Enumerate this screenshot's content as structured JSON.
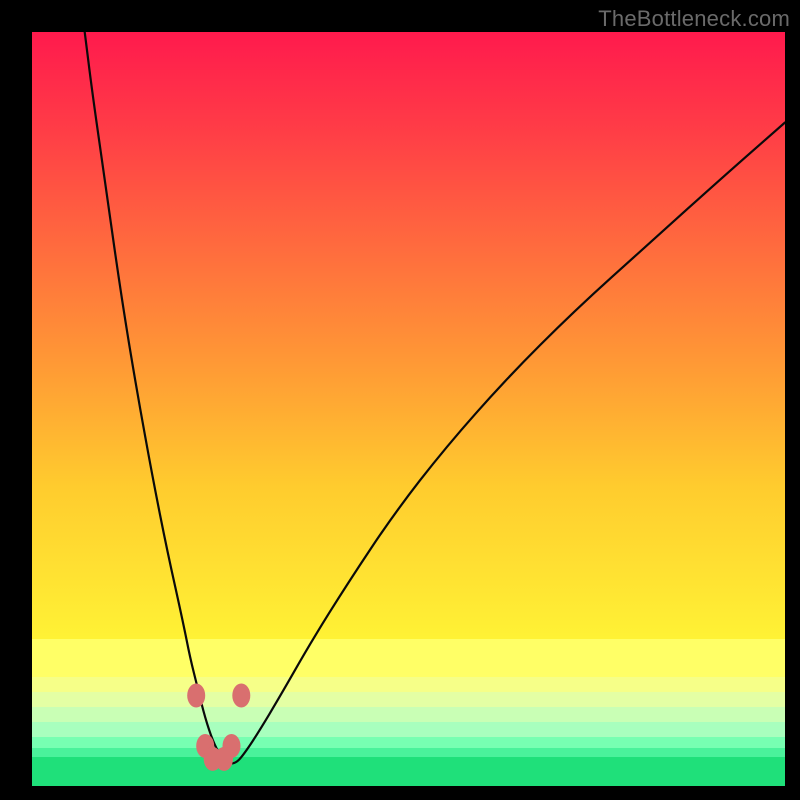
{
  "watermark": "TheBottleneck.com",
  "colors": {
    "frame": "#000000",
    "curve": "#0a0a0a",
    "markers": "#d96f6f",
    "gradient_top": "#ff1a4d",
    "gradient_bottom": "#1fe07a"
  },
  "chart_data": {
    "type": "line",
    "title": "",
    "xlabel": "",
    "ylabel": "",
    "xlim": [
      0,
      100
    ],
    "ylim": [
      0,
      100
    ],
    "series": [
      {
        "name": "bottleneck-curve",
        "x": [
          7,
          8,
          10,
          12,
          14,
          16,
          18,
          20,
          21,
          22,
          23,
          24,
          25,
          26,
          27,
          28,
          30,
          33,
          37,
          42,
          48,
          55,
          63,
          72,
          82,
          92,
          100
        ],
        "y": [
          100,
          92,
          78,
          64,
          52,
          41,
          31,
          22,
          17,
          13,
          9,
          6,
          4,
          3,
          3,
          4,
          7,
          12,
          19,
          27,
          36,
          45,
          54,
          63,
          72,
          81,
          88
        ]
      }
    ],
    "markers": [
      {
        "x": 21.8,
        "y": 12.0
      },
      {
        "x": 27.8,
        "y": 12.0
      },
      {
        "x": 23.0,
        "y": 5.3
      },
      {
        "x": 26.5,
        "y": 5.3
      },
      {
        "x": 24.0,
        "y": 3.6
      },
      {
        "x": 25.5,
        "y": 3.6
      }
    ],
    "background_gradient_meaning": "normalized score from red (high/bad) at top to green (low/good) at bottom",
    "grid": false,
    "legend": false
  }
}
